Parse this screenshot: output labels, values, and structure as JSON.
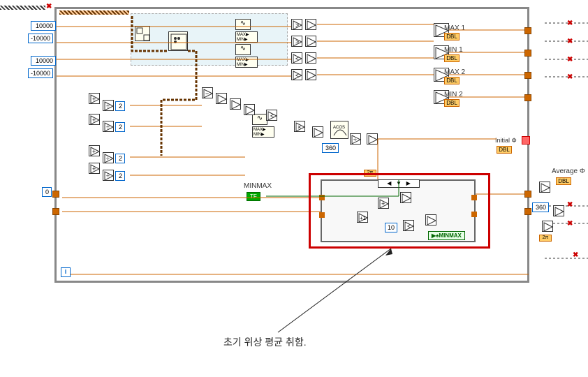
{
  "constants": {
    "c1": "10000",
    "c2": "-10000",
    "c3": "10000",
    "c4": "-10000",
    "zero": "0",
    "two_a": "2",
    "two_b": "2",
    "two_c": "2",
    "two_d": "2",
    "threesixty_a": "360",
    "threesixty_b": "360",
    "ten": "10"
  },
  "labels": {
    "max1": "MAX 1",
    "min1": "MIN 1",
    "max2": "MAX 2",
    "min2": "MIN 2",
    "initial_phi": "Initial Φ",
    "average_phi": "Average Φ",
    "minmax_control": "MINMAX",
    "minmax_local": "▶♠MINMAX",
    "dbl": "DBL",
    "tf": "TF",
    "iter": "i"
  },
  "annotation": {
    "text": "초기 위상 평균 취함."
  },
  "function_blocks": {
    "sine1": "∿",
    "sine2": "∿",
    "maxmin1": "MAX\nMIN",
    "maxmin2": "MAX\nMIN",
    "maxmin3": "MAX\nMIN"
  }
}
